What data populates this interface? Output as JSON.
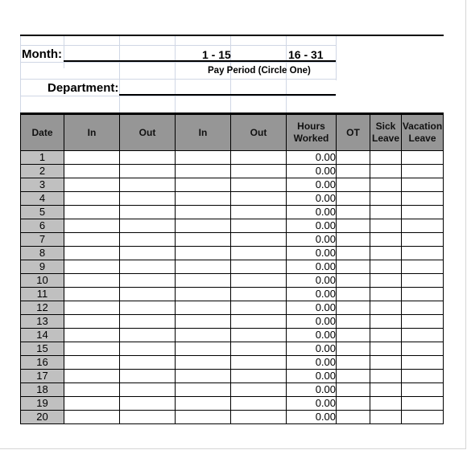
{
  "header": {
    "month_label": "Month:",
    "department_label": "Department:",
    "period_option_1": "1 - 15",
    "period_option_2": "16 - 31",
    "pay_period_label": "Pay Period (Circle One)"
  },
  "table": {
    "columns": [
      "Date",
      "In",
      "Out",
      "In",
      "Out",
      "Hours Worked",
      "OT",
      "Sick Leave",
      "Vacation Leave"
    ],
    "column_lines": [
      [
        "Date"
      ],
      [
        "In"
      ],
      [
        "Out"
      ],
      [
        "In"
      ],
      [
        "Out"
      ],
      [
        "Hours",
        "Worked"
      ],
      [
        "OT"
      ],
      [
        "Sick",
        "Leave"
      ],
      [
        "Vacation",
        "Leave"
      ]
    ],
    "rows": [
      {
        "date": "1",
        "hours": "0.00"
      },
      {
        "date": "2",
        "hours": "0.00"
      },
      {
        "date": "3",
        "hours": "0.00"
      },
      {
        "date": "4",
        "hours": "0.00"
      },
      {
        "date": "5",
        "hours": "0.00"
      },
      {
        "date": "6",
        "hours": "0.00"
      },
      {
        "date": "7",
        "hours": "0.00"
      },
      {
        "date": "8",
        "hours": "0.00"
      },
      {
        "date": "9",
        "hours": "0.00"
      },
      {
        "date": "10",
        "hours": "0.00"
      },
      {
        "date": "11",
        "hours": "0.00"
      },
      {
        "date": "12",
        "hours": "0.00"
      },
      {
        "date": "13",
        "hours": "0.00"
      },
      {
        "date": "14",
        "hours": "0.00"
      },
      {
        "date": "15",
        "hours": "0.00"
      },
      {
        "date": "16",
        "hours": "0.00"
      },
      {
        "date": "17",
        "hours": "0.00"
      },
      {
        "date": "18",
        "hours": "0.00"
      },
      {
        "date": "19",
        "hours": "0.00"
      },
      {
        "date": "20",
        "hours": "0.00"
      }
    ]
  },
  "colors": {
    "header_fill": "#969696",
    "date_fill": "#c0c0c0",
    "gridline": "#d0d7e5"
  }
}
